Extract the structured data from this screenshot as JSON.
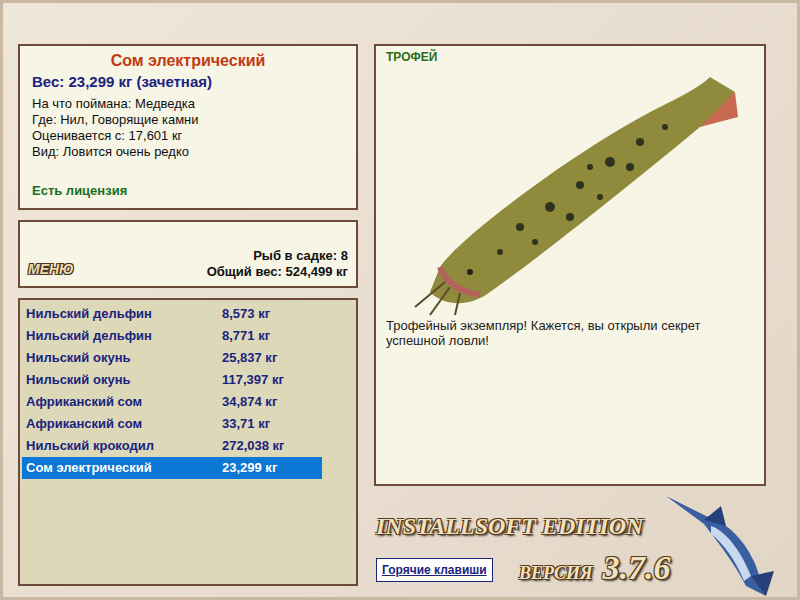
{
  "fish_info": {
    "title": "Сом электрический",
    "weight": "Вес: 23,299 кг (зачетная)",
    "lines": [
      "На что поймана: Медведка",
      "Где: Нил, Говорящие камни",
      "Оценивается с: 17,601 кг",
      "Вид: Ловится очень редко"
    ],
    "license": "Есть лицензия"
  },
  "menu": {
    "label": "МЕНЮ",
    "count": "Рыб в садке: 8",
    "total": "Общий вес: 524,499 кг"
  },
  "catch_list": [
    {
      "name": "Нильский дельфин",
      "weight": "8,573 кг",
      "selected": false
    },
    {
      "name": "Нильский дельфин",
      "weight": "8,771 кг",
      "selected": false
    },
    {
      "name": "Нильский окунь",
      "weight": "25,837 кг",
      "selected": false
    },
    {
      "name": "Нильский окунь",
      "weight": "117,397 кг",
      "selected": false
    },
    {
      "name": "Африканский сом",
      "weight": "34,874 кг",
      "selected": false
    },
    {
      "name": "Африканский сом",
      "weight": "33,71 кг",
      "selected": false
    },
    {
      "name": "Нильский крокодил",
      "weight": "272,038 кг",
      "selected": false
    },
    {
      "name": "Сом электрический",
      "weight": "23,299 кг",
      "selected": true
    }
  ],
  "trophy": {
    "label": "ТРОФЕЙ",
    "message": "Трофейный экземпляр! Кажется, вы открыли секрет успешной ловли!"
  },
  "branding": {
    "edition": "INSTALLSOFT EDITION",
    "version_label": "ВЕРСИЯ",
    "version": "3.7.6"
  },
  "hotkeys_button": "Горячие клавиши"
}
